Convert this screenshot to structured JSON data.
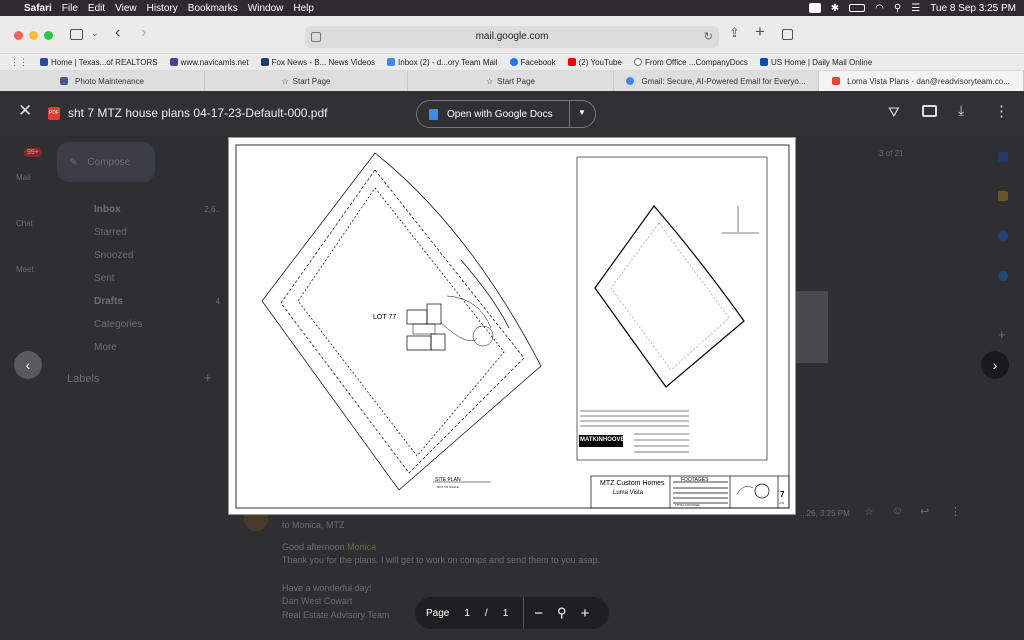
{
  "menubar": {
    "app": "Safari",
    "items": [
      "File",
      "Edit",
      "View",
      "History",
      "Bookmarks",
      "Window",
      "Help"
    ],
    "datetime": "Tue 8 Sep  3:25 PM"
  },
  "toolbar": {
    "address": "mail.google.com"
  },
  "bookmarks": [
    {
      "label": "Home | Texas...of REALTORS",
      "color": "#2b4c9b"
    },
    {
      "label": "www.navicamls.net",
      "color": "#5a3c8c"
    },
    {
      "label": "Fox News - B... News Videos",
      "color": "#1f3b73"
    },
    {
      "label": "Inbox (2) - d...ory Team Mail",
      "color": "#4285f4"
    },
    {
      "label": "Facebook",
      "color": "#1877f2"
    },
    {
      "label": "(2) YouTube",
      "color": "#ff0000"
    },
    {
      "label": "From Office ...CompanyDocs",
      "color": "#777777"
    },
    {
      "label": "US Home | Daily Mail Online",
      "color": "#004db3"
    }
  ],
  "tabs": [
    {
      "label": "Photo Maintenance"
    },
    {
      "label": "Start Page"
    },
    {
      "label": "Start Page"
    },
    {
      "label": "Gmail: Secure, AI-Powered Email for Everyo..."
    },
    {
      "label": "Loma Vista Plans - dan@readvisoryteam.co..."
    }
  ],
  "viewer": {
    "filename": "sht 7 MTZ house plans 04-17-23-Default-000.pdf",
    "open_with": "Open with Google Docs"
  },
  "gmail": {
    "badge": "99+",
    "compose": "Compose",
    "nav": [
      "Inbox",
      "Starred",
      "Snoozed",
      "Sent",
      "Drafts",
      "Categories",
      "More"
    ],
    "inbox_count": "2,6..",
    "drafts_count": "4",
    "labels": "Labels",
    "rail": [
      "Mail",
      "Chat",
      "Meet"
    ],
    "pager": "3 of 21",
    "sender": "to Monica, MTZ",
    "greeting": "Good afternoon",
    "greeting_name": "Monica",
    "body": "Thank you for the plans. I will get to work on comps and send them to you asap.",
    "closing": "Have a wonderful day!",
    "sig_name": "Dan West Cowart",
    "sig_team": "Real Estate Advisory Team",
    "time": "...26, 3:25 PM"
  },
  "plan": {
    "lot": "LOT 77",
    "site_plan": "SITE PLAN",
    "scale": "NOT TO SCALE",
    "logo": "MATKINHOOVER",
    "builder": "MTZ Custom Homes",
    "community": "Luma Vista",
    "footages": "FOOTAGES",
    "sheet": "7",
    "sheet_sub": "of 8",
    "total": "TOTAL FOOTAGE"
  },
  "pager": {
    "label": "Page",
    "current": "1",
    "sep": "/",
    "total": "1"
  }
}
